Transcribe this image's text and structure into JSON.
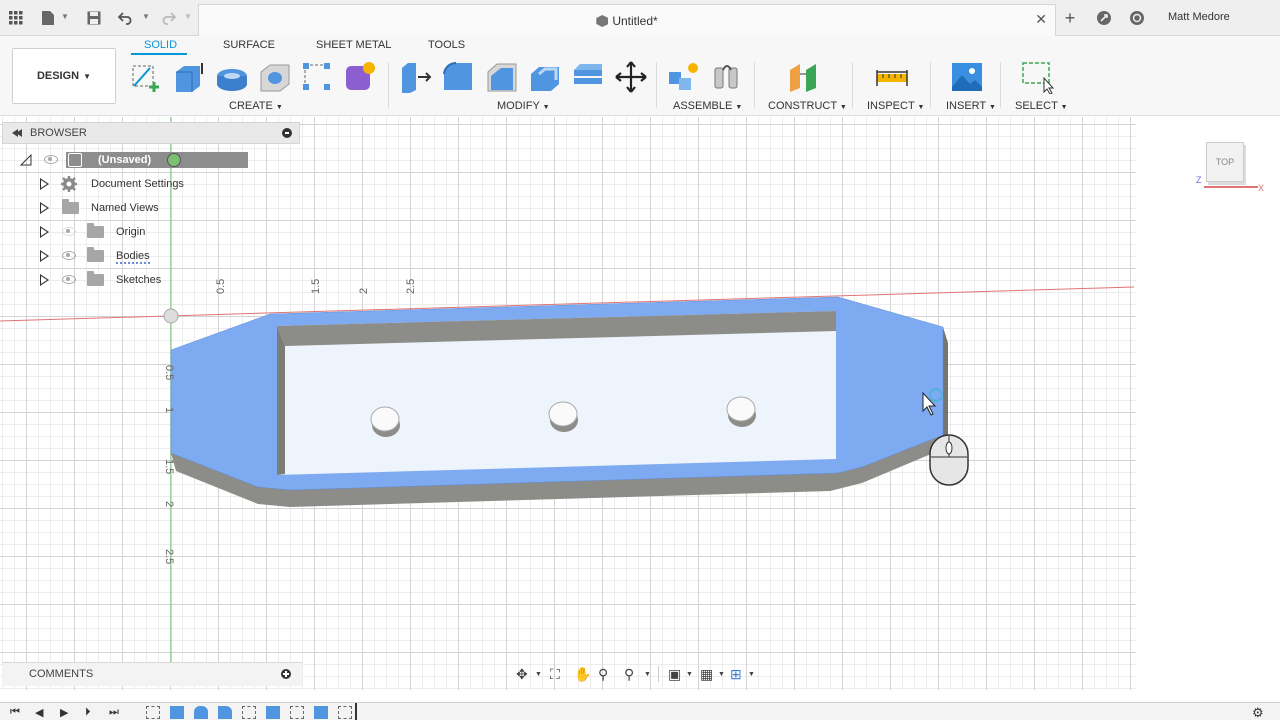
{
  "titlebar": {
    "doc_title": "Untitled*",
    "user_name": "Matt Medore",
    "icons": [
      "grid-menu-icon",
      "file-icon",
      "save-icon",
      "undo-icon",
      "redo-icon",
      "new-tab-icon",
      "job-status-icon",
      "help-icon"
    ]
  },
  "toolbar": {
    "workspace_label": "DESIGN",
    "mode_tabs": [
      "SOLID",
      "SURFACE",
      "SHEET METAL",
      "TOOLS"
    ],
    "active_tab": "SOLID",
    "groups": {
      "create": "CREATE",
      "modify": "MODIFY",
      "assemble": "ASSEMBLE",
      "construct": "CONSTRUCT",
      "inspect": "INSPECT",
      "insert": "INSERT",
      "select": "SELECT"
    }
  },
  "browser": {
    "title": "BROWSER",
    "root": "(Unsaved)",
    "items": [
      {
        "label": "Document Settings",
        "icon": "gear-icon"
      },
      {
        "label": "Named Views",
        "icon": "folder-icon"
      },
      {
        "label": "Origin",
        "icon": "folder-icon"
      },
      {
        "label": "Bodies",
        "icon": "folder-icon"
      },
      {
        "label": "Sketches",
        "icon": "folder-icon"
      }
    ]
  },
  "comments": {
    "title": "COMMENTS"
  },
  "viewcube": {
    "face_label": "TOP",
    "axis_x": "X",
    "axis_z": "Z"
  },
  "viewport": {
    "ruler_top": [
      "0.5",
      "1.5",
      "2",
      "2.5"
    ],
    "ruler_left": [
      "0.5",
      "1",
      "1.5",
      "2",
      "2.5"
    ]
  },
  "colors": {
    "accent": "#0696d7",
    "body_face": "#7eaaf2",
    "inner_face": "#eef4fc",
    "wall": "#8c8c88"
  }
}
